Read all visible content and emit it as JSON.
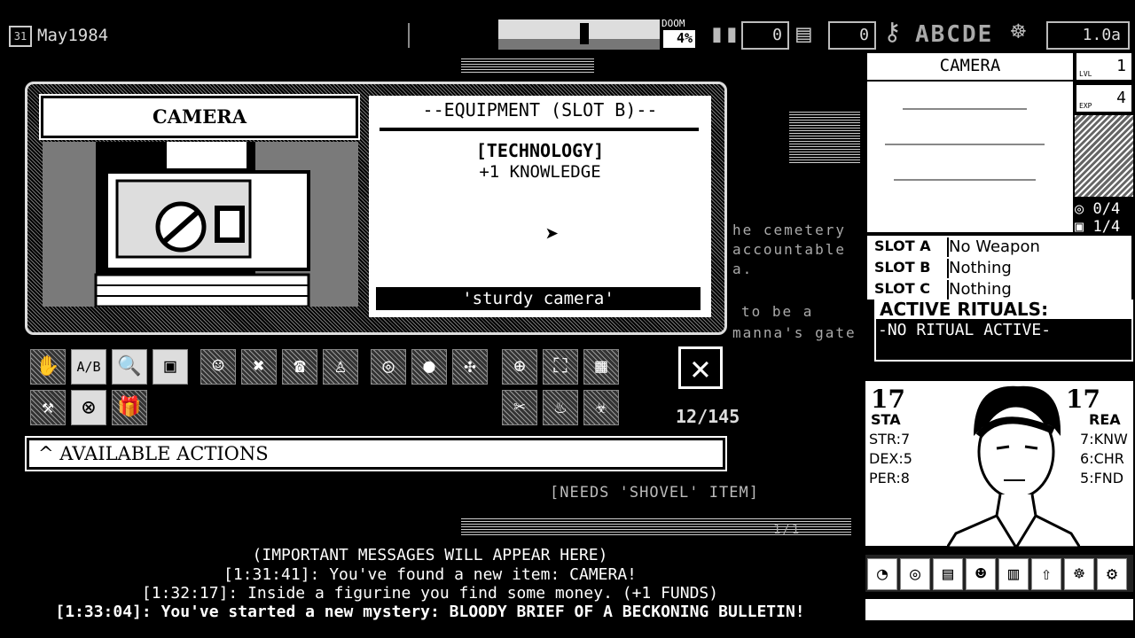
{
  "date": {
    "icon": "31",
    "text": "May1984"
  },
  "doom": {
    "label": "DOOM",
    "value": "4%"
  },
  "counters": {
    "ammo": "0",
    "funds": "0"
  },
  "keys_letters": "ABCDE",
  "version": "1.0a",
  "item": {
    "name": "CAMERA",
    "equip_header": "--EQUIPMENT (SLOT B)--",
    "category": "[TECHNOLOGY]",
    "bonus": "+1 KNOWLEDGE",
    "quote": "'sturdy camera'"
  },
  "actions": {
    "counter": "12/145",
    "available_label": "^ AVAILABLE ACTIONS",
    "needs": "[NEEDS 'SHOVEL' ITEM]",
    "ab_icon": "A/B"
  },
  "background_text": {
    "line1": "he cemetery",
    "line2": "accountable",
    "line3": "a.",
    "line4": "to be a",
    "line5": "manna's gate",
    "page_count": "1/1"
  },
  "messages": {
    "header": "(IMPORTANT MESSAGES WILL APPEAR HERE)",
    "m1": "[1:31:41]: You've found a new item: CAMERA!",
    "m2": "[1:32:17]: Inside a figurine you find some money. (+1 FUNDS)",
    "m3": "[1:33:04]: You've started a new mystery: BLOODY BRIEF OF A BECKONING BULLETIN!"
  },
  "character": {
    "name": "CAMERA",
    "lvl_label": "LVL",
    "lvl": "1",
    "exp_label": "EXP",
    "exp": "4",
    "spiral_count": "0/4",
    "lock_count": "1/4",
    "slots": [
      {
        "label": "SLOT A",
        "value": "No Weapon"
      },
      {
        "label": "SLOT B",
        "value": "Nothing"
      },
      {
        "label": "SLOT C",
        "value": "Nothing"
      }
    ],
    "rituals_header": "ACTIVE RITUALS:",
    "rituals_value": "-NO RITUAL ACTIVE-",
    "sta": "17",
    "sta_label": "STA",
    "rea": "17",
    "rea_label": "REA",
    "left_stats": [
      {
        "label": "STR",
        "value": "7"
      },
      {
        "label": "DEX",
        "value": "5"
      },
      {
        "label": "PER",
        "value": "8"
      }
    ],
    "right_stats": [
      {
        "label": "KNW",
        "value": "7"
      },
      {
        "label": "CHR",
        "value": "6"
      },
      {
        "label": "FND",
        "value": "5"
      }
    ]
  },
  "colors": {
    "bg": "#000000",
    "fg": "#ffffff",
    "dither": "#888888"
  }
}
